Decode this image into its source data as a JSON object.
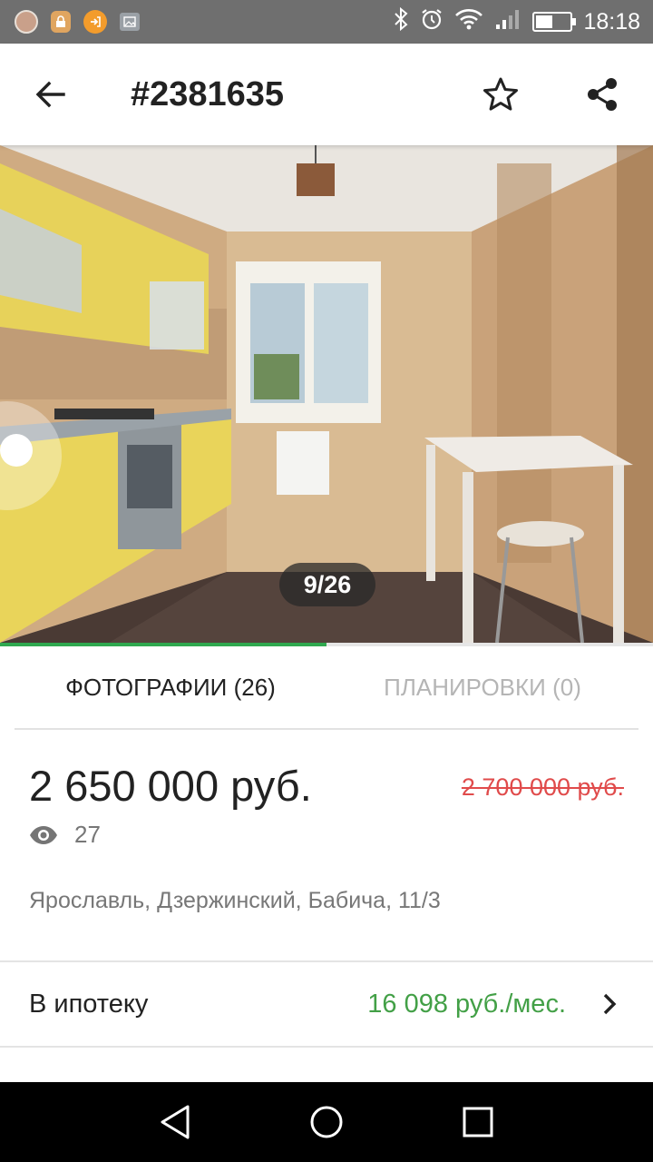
{
  "status_bar": {
    "time": "18:18",
    "icons": [
      "avatar-icon",
      "lock-app-icon",
      "login-app-icon",
      "image-icon",
      "bluetooth-icon",
      "alarm-icon",
      "wifi-icon",
      "signal-icon",
      "battery-icon"
    ],
    "battery_level_percent": 40
  },
  "toolbar": {
    "title": "#2381635",
    "back_icon": "arrow-left-icon",
    "favorite_icon": "star-outline-icon",
    "share_icon": "share-icon"
  },
  "gallery": {
    "counter": "9/26",
    "current": 9,
    "total": 26,
    "progress_fraction": 0.5
  },
  "tabs": [
    {
      "label": "ФОТОГРАФИИ (26)",
      "active": true
    },
    {
      "label": "ПЛАНИРОВКИ (0)",
      "active": false
    }
  ],
  "listing": {
    "price": "2 650 000 руб.",
    "old_price": "2 700 000 руб.",
    "views": "27",
    "address": "Ярославль, Дзержинский, Бабича, 11/3"
  },
  "mortgage": {
    "label": "В ипотеку",
    "value": "16 098 руб./мес."
  },
  "colors": {
    "accent_green": "#2fa84f",
    "price_green": "#43a047",
    "old_price_red": "#e04b4b"
  }
}
